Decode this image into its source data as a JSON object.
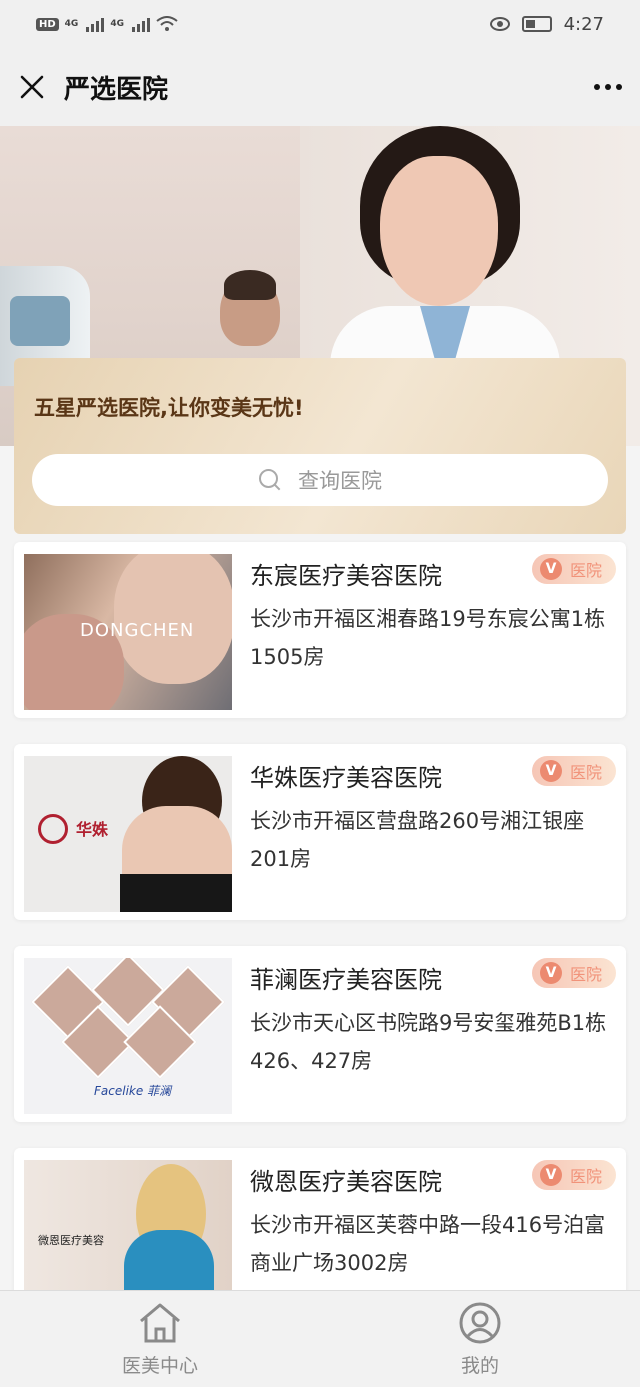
{
  "status_bar": {
    "hd": "HD",
    "net1": "4G",
    "net2": "4G",
    "time": "4:27"
  },
  "nav": {
    "title": "严选医院"
  },
  "hero": {
    "slogan": "五星严选医院,让你变美无忧!",
    "search": {
      "placeholder": "查询医院"
    }
  },
  "badge_label": "医院",
  "badge_v": "V",
  "hospitals": [
    {
      "name": "东宸医疗美容医院",
      "address": "长沙市开福区湘春路19号东宸公寓1栋1505房",
      "thumb_text": "DONGCHEN"
    },
    {
      "name": "华姝医疗美容医院",
      "address": "长沙市开福区营盘路260号湘江银座201房",
      "thumb_text": "华姝"
    },
    {
      "name": "菲澜医疗美容医院",
      "address": "长沙市天心区书院路9号安玺雅苑B1栋426、427房",
      "thumb_text": "Facelike 菲澜"
    },
    {
      "name": "微恩医疗美容医院",
      "address": "长沙市开福区芙蓉中路一段416号泊富商业广场3002房",
      "thumb_text": "微恩医疗美容"
    }
  ],
  "tabs": [
    {
      "label": "医美中心",
      "icon": "home-icon"
    },
    {
      "label": "我的",
      "icon": "user-icon"
    }
  ],
  "colors": {
    "gold_text": "#5a3616",
    "badge_text": "#f1937a",
    "badge_v_bg": "#ec8a70"
  }
}
